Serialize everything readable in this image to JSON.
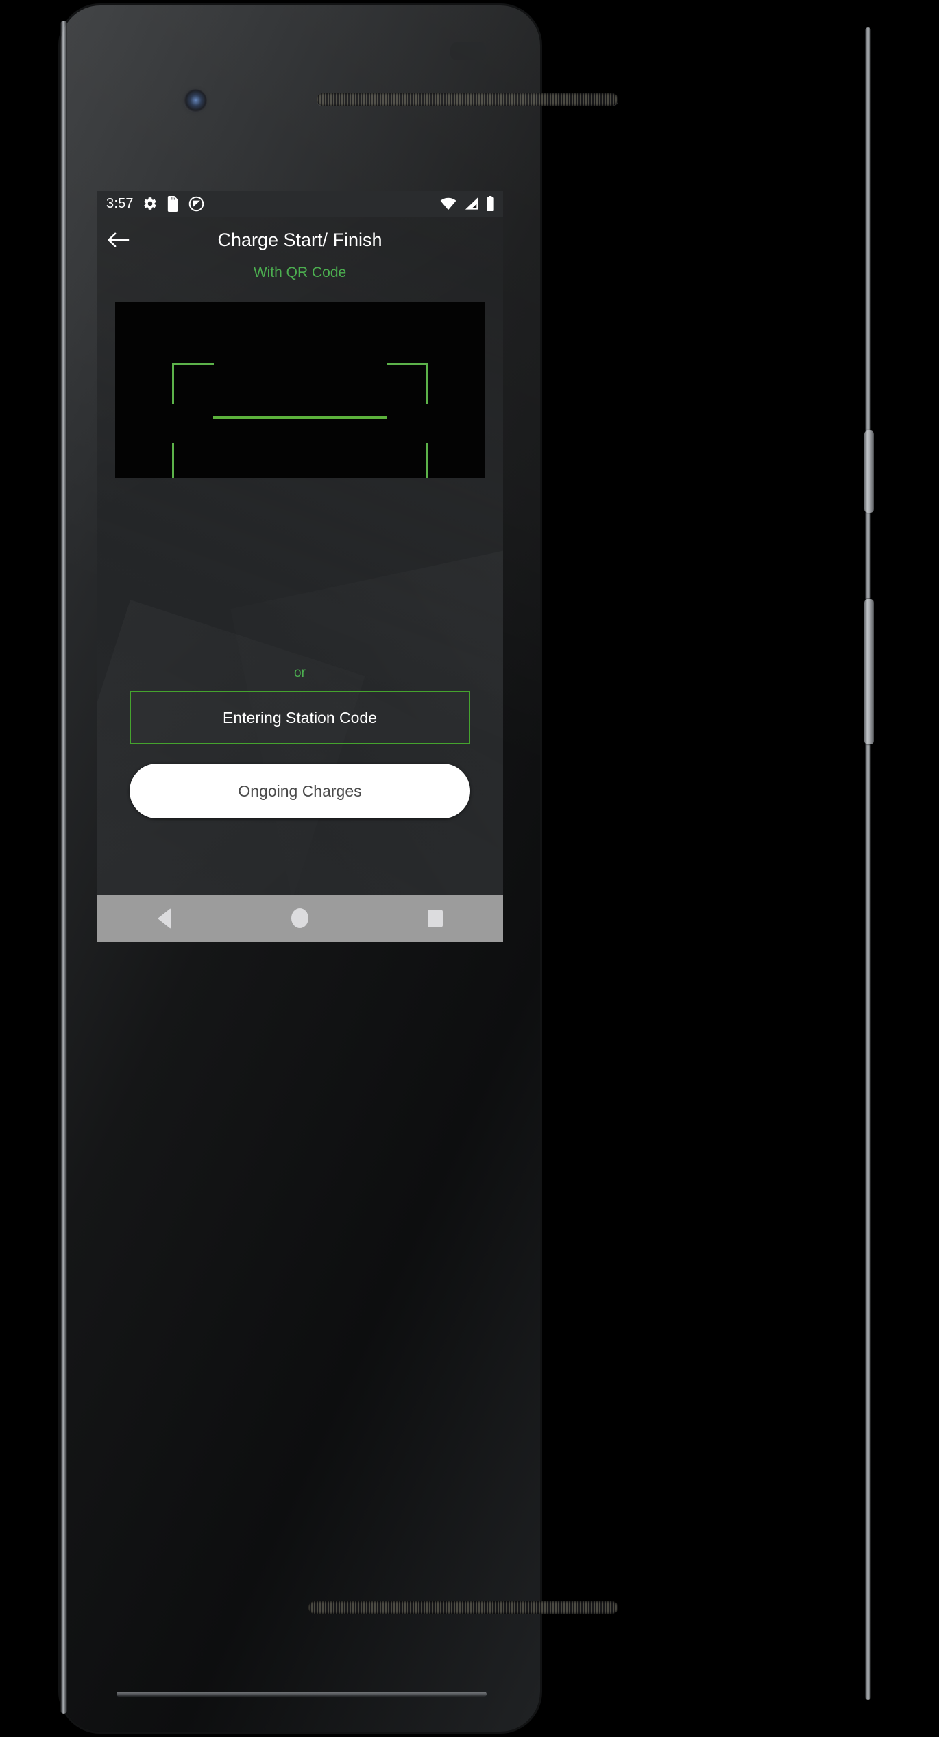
{
  "device": {
    "name": "android-phone",
    "front_camera": "front-camera-icon",
    "earpiece": "earpiece-speaker",
    "bottom_speaker": "bottom-speaker",
    "power_button": "power-button",
    "volume_button": "volume-button"
  },
  "status_bar": {
    "clock": "3:57",
    "background_color": "#2a2c2e",
    "left_icons": [
      {
        "name": "settings-gear-icon"
      },
      {
        "name": "sd-card-icon"
      },
      {
        "name": "do-not-disturb-icon"
      }
    ],
    "right_icons": [
      {
        "name": "wifi-icon"
      },
      {
        "name": "cellular-signal-icon"
      },
      {
        "name": "battery-full-icon"
      }
    ]
  },
  "app_bar": {
    "back_label": "back-arrow-icon",
    "title": "Charge Start/ Finish",
    "title_color": "#ffffff",
    "background_color": "#232527"
  },
  "main": {
    "qr_subtitle": "With QR Code",
    "qr_subtitle_color": "#4caf50",
    "scanner": {
      "name": "qr-scanner-viewport",
      "background_color": "#030303",
      "corner_color": "#5cb24a",
      "scan_line_color": "#5cb23c"
    },
    "or_label": "or",
    "or_label_color": "#4caf50",
    "station_code_button": {
      "label": "Entering Station Code",
      "border_color": "#45a32e",
      "text_color": "#ffffff"
    },
    "ongoing_charges_button": {
      "label": "Ongoing Charges",
      "background_color": "#ffffff",
      "text_color": "#4b4b4b"
    }
  },
  "nav_bar": {
    "background_color": "#9c9c9c",
    "icon_color": "#dcdcde",
    "buttons": [
      {
        "name": "nav-back-button"
      },
      {
        "name": "nav-home-button"
      },
      {
        "name": "nav-recents-button"
      }
    ]
  }
}
